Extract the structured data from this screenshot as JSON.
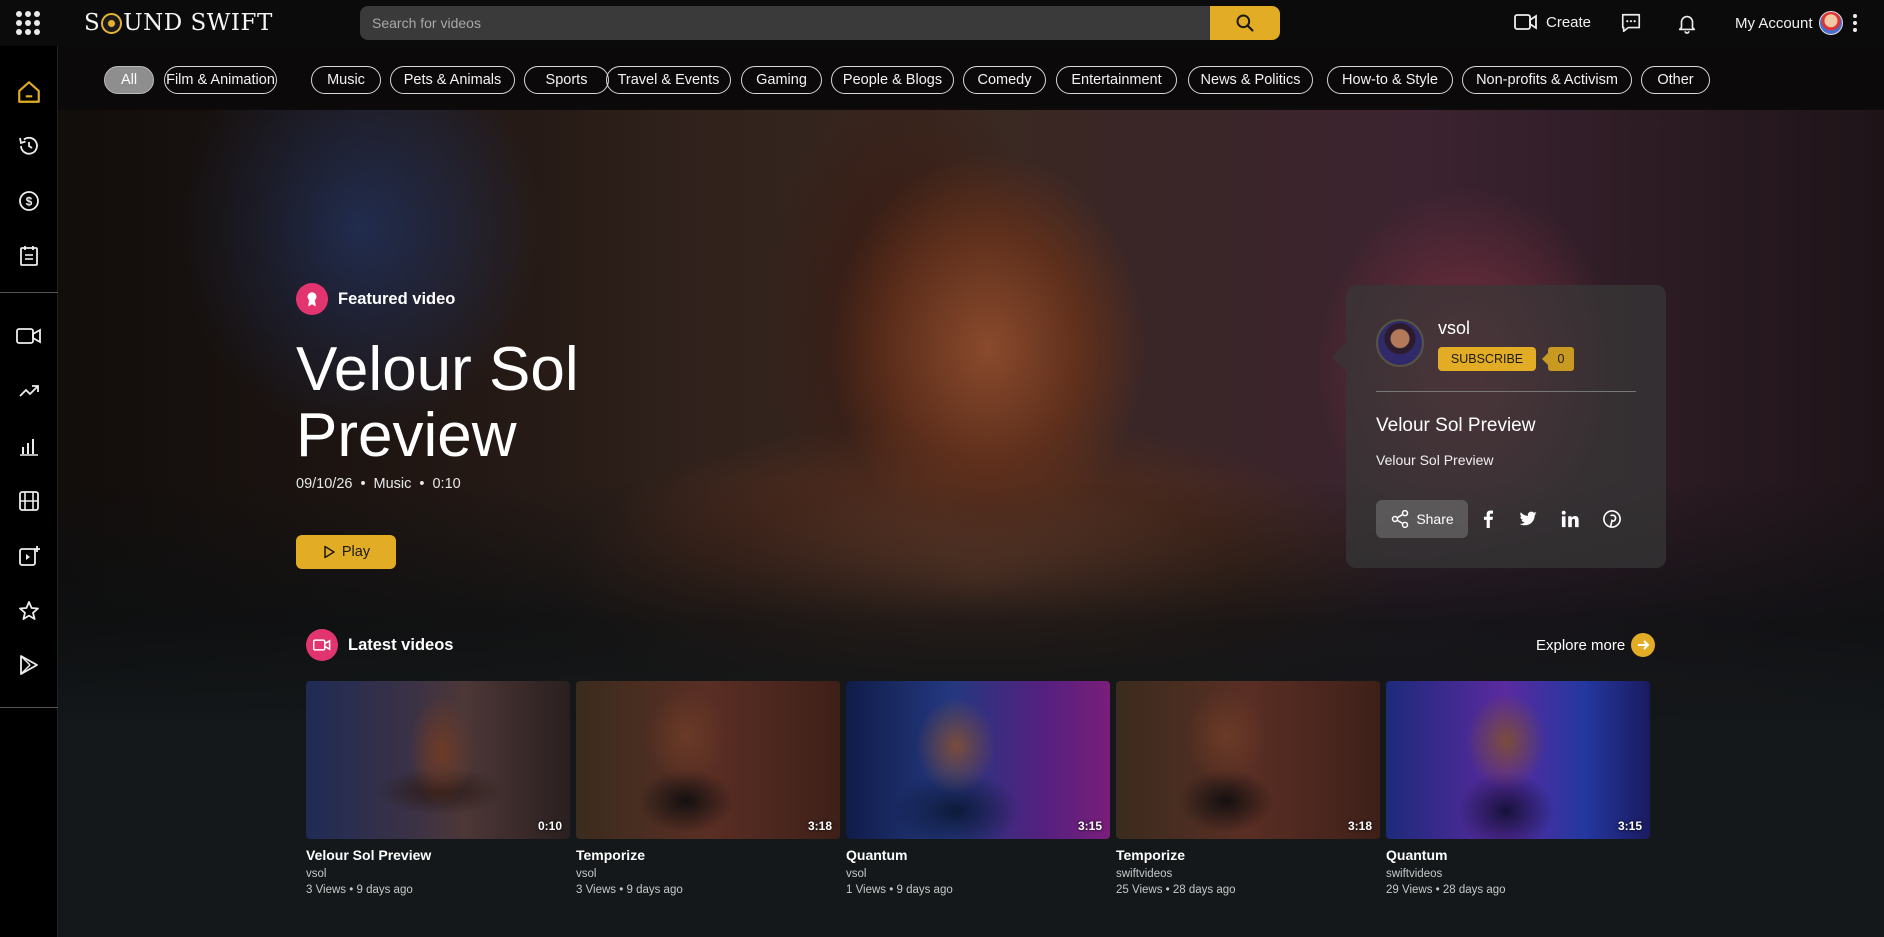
{
  "app": {
    "logo_text": "SOUND SWIFT"
  },
  "header": {
    "search": {
      "placeholder": "Search for videos",
      "value": ""
    },
    "create_label": "Create",
    "account_label": "My Account"
  },
  "sidebar": {
    "items": [
      {
        "icon": "home-icon",
        "active": true
      },
      {
        "icon": "history-icon"
      },
      {
        "icon": "dollar-icon"
      },
      {
        "icon": "playlist-icon"
      },
      {
        "icon": "camera-icon"
      },
      {
        "icon": "trending-icon"
      },
      {
        "icon": "stats-icon"
      },
      {
        "icon": "film-icon"
      },
      {
        "icon": "add-video-icon"
      },
      {
        "icon": "star-icon"
      },
      {
        "icon": "play-store-icon"
      }
    ]
  },
  "categories": [
    "All",
    "Film & Animation",
    "Music",
    "Pets & Animals",
    "Sports",
    "Travel & Events",
    "Gaming",
    "People & Blogs",
    "Comedy",
    "Entertainment",
    "News & Politics",
    "How-to & Style",
    "Non-profits & Activism",
    "Other"
  ],
  "featured": {
    "label": "Featured video",
    "title": "Velour Sol Preview",
    "date": "09/10/26",
    "category": "Music",
    "duration": "0:10",
    "play_label": "Play"
  },
  "channel_card": {
    "name": "vsol",
    "subscribe_label": "SUBSCRIBE",
    "subscriber_count": "0",
    "video_title": "Velour Sol Preview",
    "description": "Velour Sol Preview",
    "share_label": "Share"
  },
  "latest": {
    "label": "Latest videos",
    "explore_label": "Explore more",
    "videos": [
      {
        "title": "Velour Sol Preview",
        "channel": "vsol",
        "stats": "3 Views • 9 days ago",
        "duration": "0:10"
      },
      {
        "title": "Temporize",
        "channel": "vsol",
        "stats": "3 Views • 9 days ago",
        "duration": "3:18"
      },
      {
        "title": "Quantum",
        "channel": "vsol",
        "stats": "1 Views • 9 days ago",
        "duration": "3:15"
      },
      {
        "title": "Temporize",
        "channel": "swiftvideos",
        "stats": "25 Views • 28 days ago",
        "duration": "3:18"
      },
      {
        "title": "Quantum",
        "channel": "swiftvideos",
        "stats": "29 Views • 28 days ago",
        "duration": "3:15"
      }
    ]
  },
  "colors": {
    "accent": "#e2ad25",
    "badge": "#e2356f",
    "background": "#0c0c0c"
  }
}
